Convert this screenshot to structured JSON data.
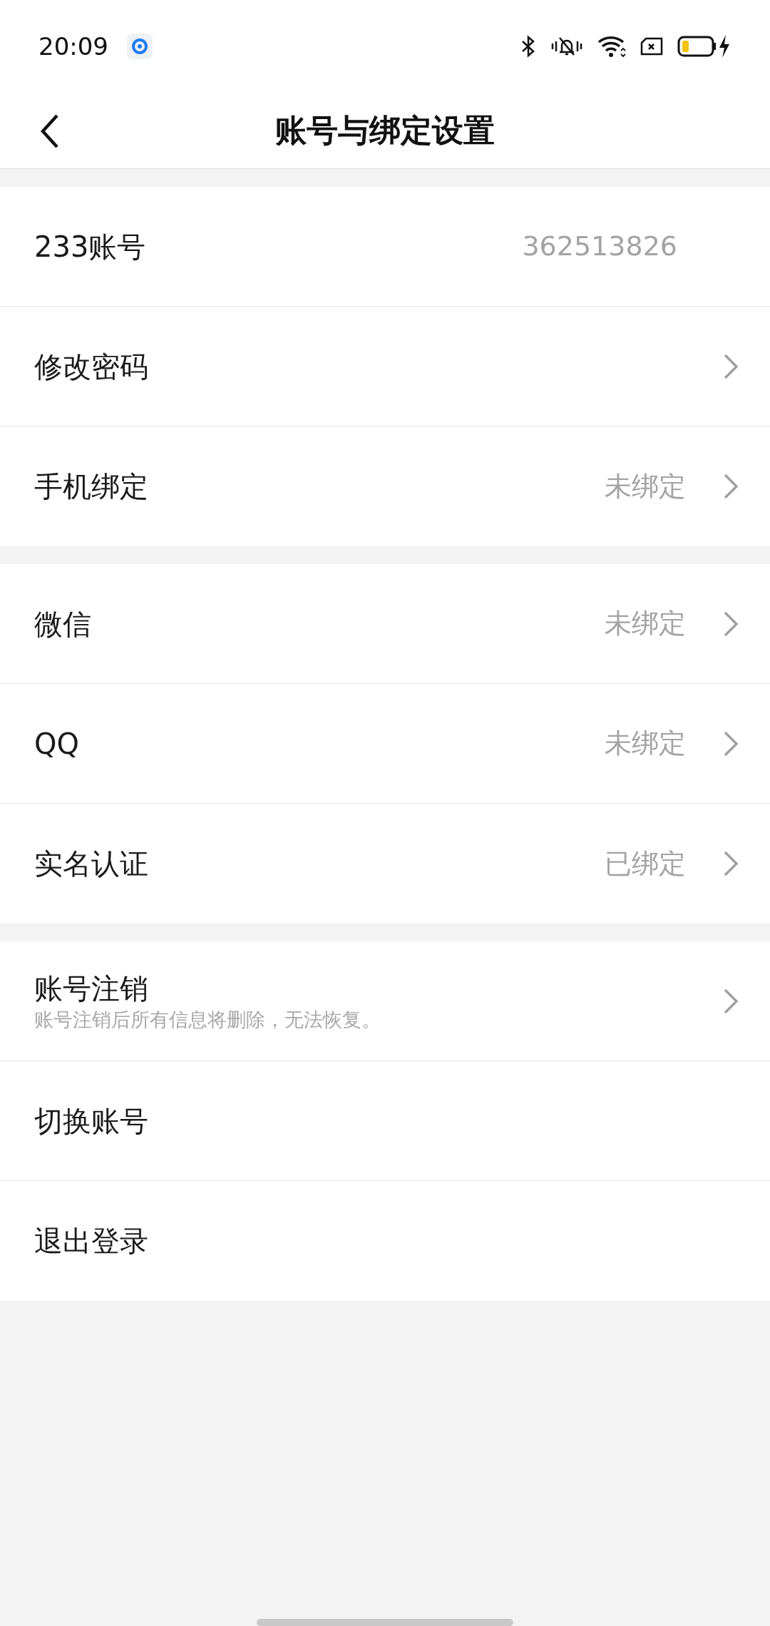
{
  "status_bar": {
    "time": "20:09"
  },
  "header": {
    "title": "账号与绑定设置"
  },
  "groups": [
    {
      "rows": [
        {
          "label": "233账号",
          "value": "362513826",
          "chevron": false
        },
        {
          "label": "修改密码",
          "chevron": true
        },
        {
          "label": "手机绑定",
          "value": "未绑定",
          "chevron": true
        }
      ]
    },
    {
      "rows": [
        {
          "label": "微信",
          "value": "未绑定",
          "chevron": true
        },
        {
          "label": "QQ",
          "value": "未绑定",
          "chevron": true
        },
        {
          "label": "实名认证",
          "value": "已绑定",
          "chevron": true
        }
      ]
    },
    {
      "rows": [
        {
          "label": "账号注销",
          "subtitle": "账号注销后所有信息将删除，无法恢复。",
          "chevron": true
        },
        {
          "label": "切换账号",
          "chevron": false
        },
        {
          "label": "退出登录",
          "chevron": false
        }
      ]
    }
  ]
}
